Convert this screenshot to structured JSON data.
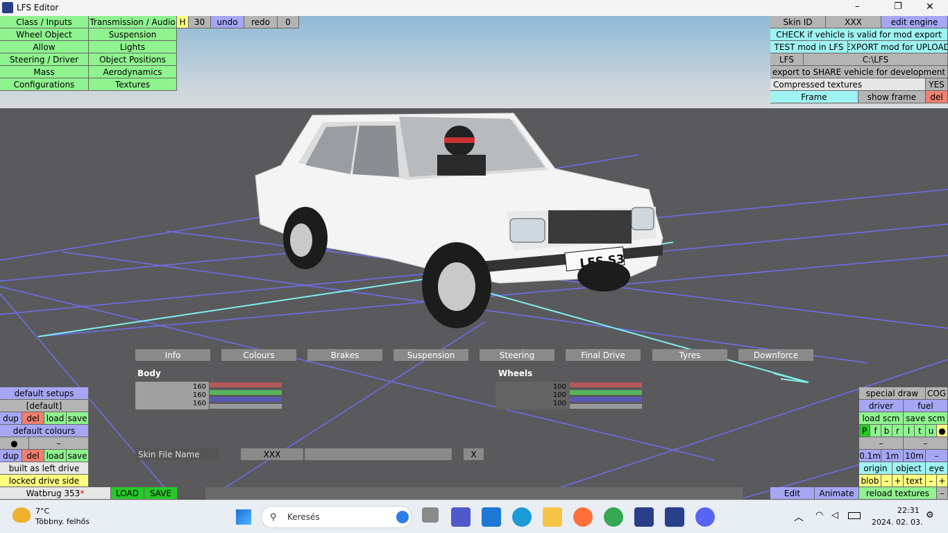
{
  "window": {
    "title": "LFS Editor",
    "minimize_label": "–",
    "maximize_label": "❐",
    "close_label": "✕"
  },
  "menu_left": {
    "items": [
      "Class / Inputs",
      "Transmission / Audio",
      "Wheel Object",
      "Suspension",
      "Allow",
      "Lights",
      "Steering / Driver",
      "Object Positions",
      "Mass",
      "Aerodynamics",
      "Configurations",
      "Textures"
    ]
  },
  "toolbar_top": {
    "h": "H",
    "value": "30",
    "undo": "undo",
    "redo": "redo",
    "zero": "0"
  },
  "menu_right": {
    "skin_id": "Skin ID",
    "skin_value": "XXX",
    "edit_engine": "edit engine",
    "check": "CHECK if vehicle is valid for mod export",
    "test": "TEST mod in LFS",
    "export": "EXPORT mod for UPLOAD",
    "lfs": "LFS",
    "lfs_path": "C:\\LFS",
    "share": "export to SHARE vehicle for development",
    "compressed": "Compressed textures",
    "compressed_value": "YES",
    "frame": "Frame",
    "show_frame": "show frame",
    "del": "del"
  },
  "scene": {
    "plate": "LFS S3",
    "axis_color": "#6e6ef0",
    "axis_cyan": "#7ff0f0"
  },
  "tabs": [
    "Info",
    "Colours",
    "Brakes",
    "Suspension",
    "Steering",
    "Final Drive",
    "Tyres",
    "Downforce"
  ],
  "colours": {
    "body_label": "Body",
    "body_values": [
      "160",
      "160",
      "160"
    ],
    "wheels_label": "Wheels",
    "wheels_values": [
      "100",
      "100",
      "100"
    ]
  },
  "skin": {
    "label": "Skin File Name",
    "value": "XXX",
    "clear": "X"
  },
  "left_panel": {
    "default_setups": "default setups",
    "default_bracket": "[default]",
    "dup": "dup",
    "del": "del",
    "load": "load",
    "save": "save",
    "default_colours": "default colours",
    "dot": "●",
    "dash": "–",
    "built_left": "built as left drive",
    "locked_side": "locked drive side",
    "car_name": "Watbrug 353",
    "car_star": "*",
    "load_big": "LOAD",
    "save_big": "SAVE"
  },
  "right_panel": {
    "special_draw": "special draw",
    "cog": "COG",
    "driver": "driver",
    "fuel": "fuel",
    "load_scm": "load scm",
    "save_scm": "save scm",
    "letters": [
      "P",
      "f",
      "b",
      "r",
      "l",
      "t",
      "u",
      "●"
    ],
    "dash": "–",
    "step_01": "0.1m",
    "step_1": "1m",
    "step_10": "10m",
    "origin": "origin",
    "object": "object",
    "eye": "eye",
    "blob": "blob",
    "minus": "–",
    "plus": "+",
    "text": "text",
    "edit": "Edit",
    "animate": "Animate",
    "reload": "reload textures"
  },
  "taskbar": {
    "temp": "7°C",
    "weather": "Többny. felhős",
    "search": "Keresés",
    "time": "22:31",
    "date": "2024. 02. 03."
  }
}
